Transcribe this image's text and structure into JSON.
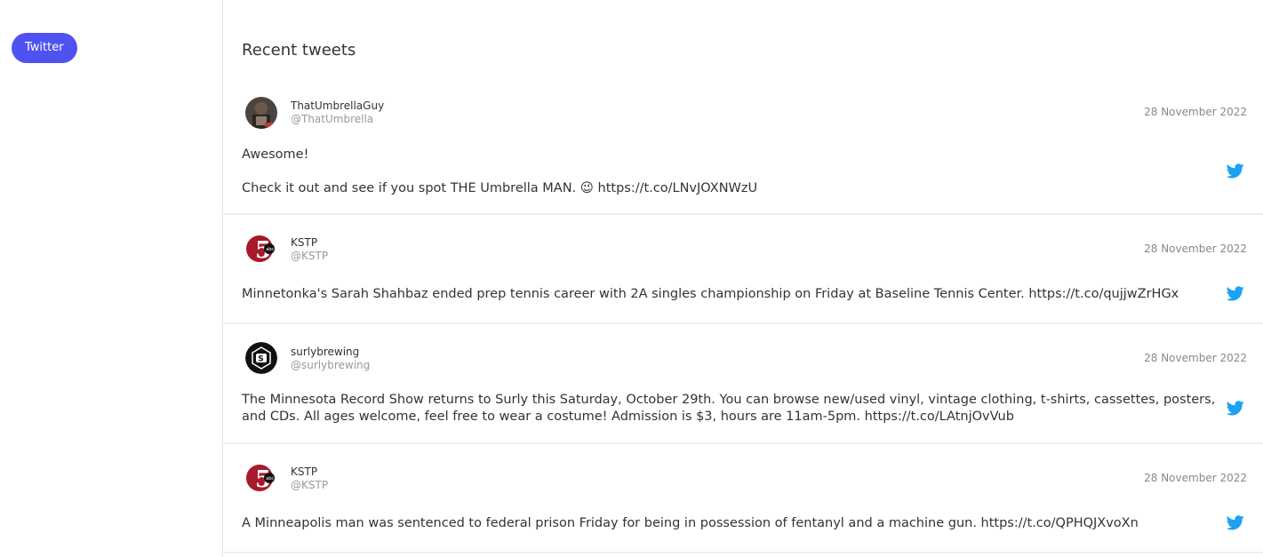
{
  "sidebar": {
    "twitter_label": "Twitter"
  },
  "main": {
    "heading": "Recent tweets",
    "tweets": [
      {
        "name": "ThatUmbrellaGuy",
        "handle": "@ThatUmbrella",
        "date": "28 November 2022",
        "line1": "Awesome!",
        "line2": "Check it out and see if you spot THE Umbrella MAN. 😉 https://t.co/LNvJOXNWzU"
      },
      {
        "name": "KSTP",
        "handle": "@KSTP",
        "date": "28 November 2022",
        "line1": "Minnetonka's Sarah Shahbaz ended prep tennis career with 2A singles championship on Friday at Baseline Tennis Center. https://t.co/qujjwZrHGx"
      },
      {
        "name": "surlybrewing",
        "handle": "@surlybrewing",
        "date": "28 November 2022",
        "line1": "The Minnesota Record Show returns to Surly this Saturday, October 29th. You can browse new/used vinyl, vintage clothing, t-shirts, cassettes, posters, and CDs. All ages welcome, feel free to wear a costume! Admission is $3, hours are 11am-5pm. https://t.co/LAtnjOvVub"
      },
      {
        "name": "KSTP",
        "handle": "@KSTP",
        "date": "28 November 2022",
        "line1": "A Minneapolis man was sentenced to federal prison Friday for being in possession of fentanyl and a machine gun. https://t.co/QPHQJXvoXn"
      }
    ]
  },
  "colors": {
    "accent": "#4f52f0",
    "twitter_blue": "#1da1f2"
  },
  "icons": {
    "tweet_source": "twitter-bird-icon",
    "kstp_logo": "kstp-5-abc-logo",
    "surly_logo": "surly-s-logo"
  }
}
